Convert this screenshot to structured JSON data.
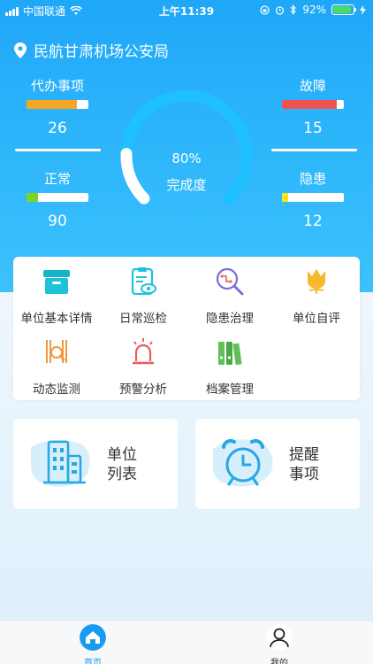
{
  "status_bar": {
    "carrier": "中国联通",
    "time": "上午11:39",
    "battery_percent": "92%",
    "battery_level": 0.92
  },
  "location": {
    "name": "民航甘肃机场公安局",
    "icon": "location-pin-icon"
  },
  "stats": {
    "todo": {
      "label": "代办事项",
      "value": "26",
      "fill": 0.82,
      "color": "#f5a623"
    },
    "fault": {
      "label": "故障",
      "value": "15",
      "fill": 0.88,
      "color": "#ef5350"
    },
    "normal": {
      "label": "正常",
      "value": "90",
      "fill": 0.18,
      "color": "#7ed321"
    },
    "hazard": {
      "label": "隐患",
      "value": "12",
      "fill": 0.1,
      "color": "#f8e71c"
    }
  },
  "gauge": {
    "percent_text": "80%",
    "percent_value": 80,
    "caption": "完成度"
  },
  "menu": [
    {
      "label": "单位基本详情",
      "icon": "archive-box-icon"
    },
    {
      "label": "日常巡检",
      "icon": "clipboard-eye-icon"
    },
    {
      "label": "隐患治理",
      "icon": "magnifier-circuit-icon"
    },
    {
      "label": "单位自评",
      "icon": "tulip-icon"
    },
    {
      "label": "动态监测",
      "icon": "monitor-chart-icon"
    },
    {
      "label": "预警分析",
      "icon": "alarm-light-icon"
    },
    {
      "label": "档案管理",
      "icon": "binders-icon"
    }
  ],
  "cards": {
    "unit_list": {
      "line1": "单位",
      "line2": "列表",
      "icon": "building-icon"
    },
    "reminders": {
      "line1": "提醒",
      "line2": "事项",
      "icon": "alarm-clock-icon"
    }
  },
  "tabbar": {
    "home": {
      "label": "首页",
      "icon": "home-icon",
      "active_color": "#1b9bf0"
    },
    "mine": {
      "label": "我的",
      "icon": "user-icon"
    }
  }
}
